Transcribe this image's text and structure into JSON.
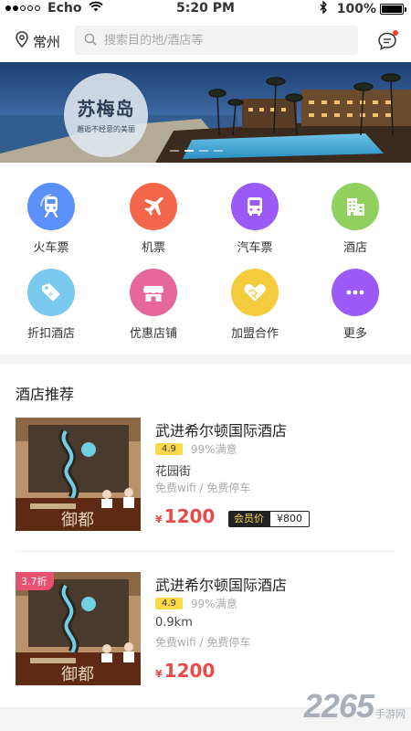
{
  "status_bar": {
    "carrier": "Echo",
    "time": "5:20 PM",
    "battery": "100%"
  },
  "header": {
    "city": "常州",
    "search_placeholder": "搜索目的地/酒店等"
  },
  "banner": {
    "title": "苏梅岛",
    "subtitle": "邂逅不经意的美丽",
    "slides": 4,
    "active_slide": 2
  },
  "categories": [
    {
      "label": "火车票",
      "icon": "train-icon",
      "color": "#5b8ff9"
    },
    {
      "label": "机票",
      "icon": "plane-icon",
      "color": "#f4664a"
    },
    {
      "label": "汽车票",
      "icon": "bus-icon",
      "color": "#9b59f5"
    },
    {
      "label": "酒店",
      "icon": "building-icon",
      "color": "#8fd05f"
    },
    {
      "label": "折扣酒店",
      "icon": "discount-tag-icon",
      "color": "#79c8ee"
    },
    {
      "label": "优惠店铺",
      "icon": "shop-icon",
      "color": "#e7679a"
    },
    {
      "label": "加盟合作",
      "icon": "handshake-icon",
      "color": "#f5cb3e"
    },
    {
      "label": "更多",
      "icon": "more-icon",
      "color": "#9b59f5"
    }
  ],
  "hotel_section": {
    "title": "酒店推荐",
    "hotels": [
      {
        "name": "武进希尔顿国际酒店",
        "score": "4.9",
        "satisfaction": "99%满意",
        "area": "花园街",
        "amenities": "免费wifi / 免费停车",
        "currency": "¥",
        "price": "1200",
        "member_label": "会员价",
        "member_price": "¥800"
      },
      {
        "discount": "3.7折",
        "name": "武进希尔顿国际酒店",
        "score": "4.9",
        "satisfaction": "99%满意",
        "area": "0.9km",
        "amenities": "免费wifi / 免费停车",
        "currency": "¥",
        "price": "1200"
      }
    ]
  },
  "watermark": {
    "number": "2265",
    "text": "手游网"
  }
}
